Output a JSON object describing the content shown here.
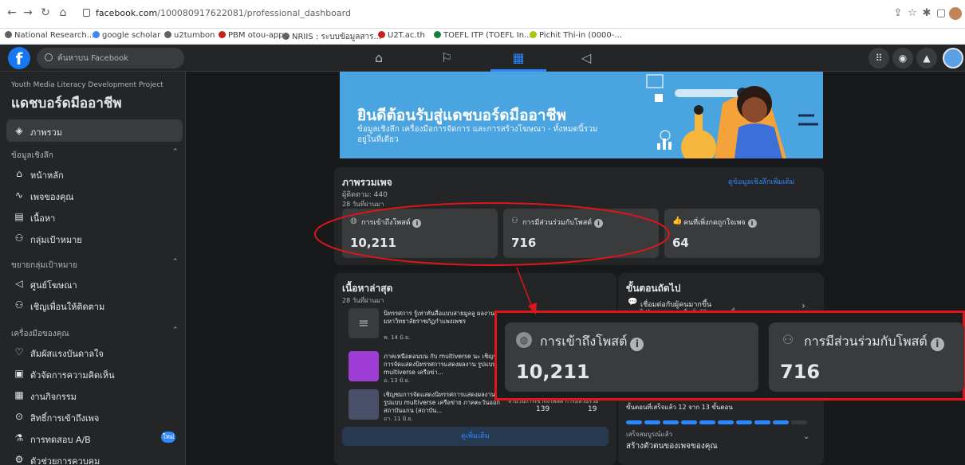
{
  "browser": {
    "url_host": "facebook.com",
    "url_path": "/100080917622081/professional_dashboard",
    "bookmarks": [
      {
        "label": "National Research...",
        "color": "#5f6368"
      },
      {
        "label": "google scholar",
        "color": "#4285f4"
      },
      {
        "label": "u2tumbon",
        "color": "#5f6368"
      },
      {
        "label": "PBM otou-app",
        "color": "#c5221f"
      },
      {
        "label": "NRIIS : ระบบข้อมูลสาร...",
        "color": "#5f6368"
      },
      {
        "label": "U2T.ac.th",
        "color": "#c5221f"
      },
      {
        "label": "TOEFL ITP (TOEFL In...",
        "color": "#188038"
      },
      {
        "label": "Pichit Thi-in (0000-...",
        "color": "#a8c60f"
      }
    ]
  },
  "fb": {
    "logo": "f",
    "search_placeholder": "ค้นหาบน Facebook",
    "nav": [
      {
        "name": "home-icon",
        "glyph": "⌂"
      },
      {
        "name": "flag-icon",
        "glyph": "⚐"
      },
      {
        "name": "dashboard-icon",
        "glyph": "▦"
      },
      {
        "name": "megaphone-icon",
        "glyph": "📢"
      }
    ]
  },
  "sidebar": {
    "project": "Youth Media Literacy Development Project",
    "title": "แดชบอร์ดมืออาชีพ",
    "overview": "ภาพรวม",
    "section_insights": "ข้อมูลเชิงลึก",
    "insights": [
      "หน้าหลัก",
      "เพจของคุณ",
      "เนื้อหา",
      "กลุ่มเป้าหมาย"
    ],
    "section_audience": "ขยายกลุ่มเป้าหมาย",
    "audience": [
      "ศูนย์โฆษณา",
      "เชิญเพื่อนให้ติดตาม"
    ],
    "section_tools": "เครื่องมือของคุณ",
    "tools": [
      "สัมผัสแรงบันดาลใจ",
      "ตัวจัดการความคิดเห็น",
      "งานกิจกรรม",
      "สิทธิ์การเข้าถึงเพจ",
      "การทดสอบ A/B",
      "ตัวช่วยการควบคุม"
    ],
    "new_badge": "ใหม่"
  },
  "banner": {
    "title": "ยินดีต้อนรับสู่แดชบอร์ดมืออาชีพ",
    "subtitle": "ข้อมูลเชิงลึก เครื่องมือการจัดการ และการสร้างโฆษณา - ทั้งหมดนี้รวมอยู่ในที่เดียว"
  },
  "overview": {
    "title": "ภาพรวมเพจ",
    "link": "ดูข้อมูลเชิงลึกเพิ่มเติม",
    "followers": "ผู้ติดตาม: 440",
    "range": "28 วันที่ผ่านมา",
    "stats": [
      {
        "label": "การเข้าถึงโพสต์",
        "value": "10,211"
      },
      {
        "label": "การมีส่วนร่วมกับโพสต์",
        "value": "716"
      },
      {
        "label": "คนที่เพิ่งกดถูกใจเพจ",
        "value": "64"
      }
    ]
  },
  "latest": {
    "title": "เนื้อหาล่าสุด",
    "range": "28 วันที่ผ่านมา",
    "posts": [
      {
        "text": "นิทรรศการ รู้เท่าทันสื่อแบบสายมูลลู ผลงาน : มหาวิทยาลัยราชภัฏกำแพงเพชร",
        "date": "พ. 14 มิ.ย."
      },
      {
        "text": "ภาคเหนือตอนบน กับ multiverse นะ เชิญชมการจัดแสดงนิทรรศการแสดงผลงาน รูปแบบ multiverse เครือข่า...",
        "date": "อ. 13 มิ.ย."
      },
      {
        "text": "เชิญชมการจัดแสดงนิทรรศการแสดงผลงาน รูปแบบ multiverse เครือข่าย ภาคตะวันออก สถาบันแกน (สถาบัน...",
        "date": "อา. 11 มิ.ย."
      }
    ],
    "metric_headers": [
      "จำนวนการเข้าถึงโพสต์",
      "การมีส่วนร่วม"
    ],
    "metric_values": [
      "139",
      "19"
    ],
    "see_more": "ดูเพิ่มเติม"
  },
  "next": {
    "title": "ขั้นตอนถัดไป",
    "item": "เชื่อมต่อกับผู้คนมากขึ้น",
    "item_sub": "ไปกับเพจของคุณเพื่อเพิ่มผู้ติดตามมากขึ้น",
    "progress_label": "ขั้นตอนที่เสร็จแล้ว 12 จาก 13 ขั้นตอน",
    "progress_fraction": 0.92,
    "done_label": "เสร็จสมบูรณ์แล้ว",
    "done_title": "สร้างตัวตนของเพจของคุณ"
  },
  "zoom": {
    "stats": [
      {
        "label": "การเข้าถึงโพสต์",
        "value": "10,211"
      },
      {
        "label": "การมีส่วนร่วมกับโพสต์",
        "value": "716"
      }
    ]
  },
  "colors": {
    "annotation": "#e0141b",
    "accent": "#2d88ff",
    "banner": "#4aa4e0"
  }
}
